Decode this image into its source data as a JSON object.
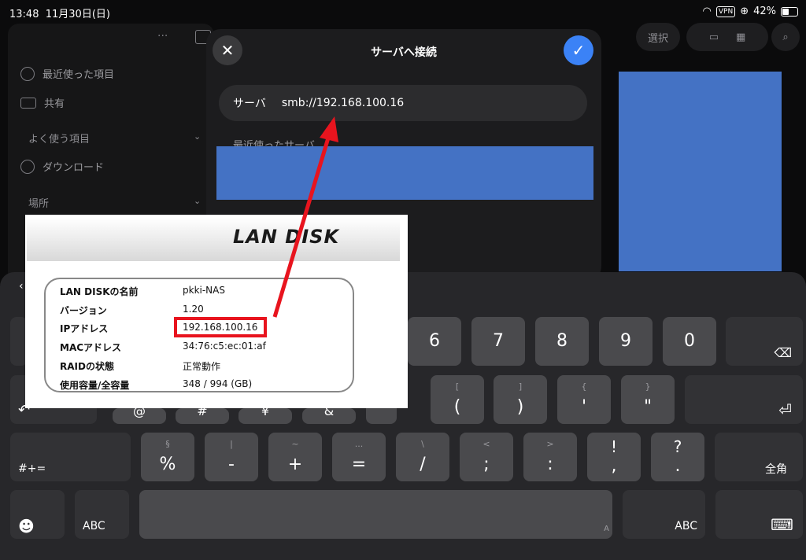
{
  "status_bar": {
    "time": "13:48",
    "date": "11月30日(日)",
    "vpn": "VPN",
    "battery": "42%"
  },
  "sidebar": {
    "ellipsis": "···",
    "items": [
      {
        "label": "最近使った項目",
        "icon": "clock-icon"
      },
      {
        "label": "共有",
        "icon": "shared-folder-icon"
      }
    ],
    "section_favorites": "よく使う項目",
    "download_label": "ダウンロード",
    "section_locations": "場所"
  },
  "toolbar": {
    "select_label": "選択"
  },
  "dialog": {
    "title": "サーバへ接続",
    "server_label": "サーバ",
    "server_value": "smb://192.168.100.16",
    "recent_label": "最近使ったサーバ"
  },
  "landisk": {
    "logo": "LAN DISK",
    "rows": [
      {
        "key": "LAN DISKの名前",
        "value": "pkki-NAS"
      },
      {
        "key": "バージョン",
        "value": "1.20"
      },
      {
        "key": "IPアドレス",
        "value": "192.168.100.16"
      },
      {
        "key": "MACアドレス",
        "value": "34:76:c5:ec:01:af"
      },
      {
        "key": "RAIDの状態",
        "value": "正常動作"
      },
      {
        "key": "使用容量/全容量",
        "value": "348 / 994 (GB)"
      }
    ]
  },
  "keyboard": {
    "row1": [
      "6",
      "7",
      "8",
      "9",
      "0"
    ],
    "row2": [
      {
        "sub": "[",
        "main": "("
      },
      {
        "sub": "]",
        "main": ")"
      },
      {
        "sub": "{",
        "main": "'"
      },
      {
        "sub": "}",
        "main": "\""
      }
    ],
    "row2_partial": [
      "@",
      "#",
      "¥",
      "&"
    ],
    "row3": [
      {
        "sub": "§",
        "main": "%"
      },
      {
        "sub": "|",
        "main": "-"
      },
      {
        "sub": "~",
        "main": "+"
      },
      {
        "sub": "...",
        "main": "="
      },
      {
        "sub": "\\",
        "main": "/"
      },
      {
        "sub": "<",
        "main": ";"
      },
      {
        "sub": ">",
        "main": ":"
      },
      {
        "sub": "!",
        "main": ","
      },
      {
        "sub": "?",
        "main": "."
      }
    ],
    "shift_label": "#+=",
    "kana_label": "全角",
    "abc_left": "ABC",
    "abc_right": "ABC"
  },
  "colors": {
    "accent_blue": "#3b82f6",
    "highlight_red": "#e8141e",
    "placeholder_blue": "#4472c4"
  }
}
